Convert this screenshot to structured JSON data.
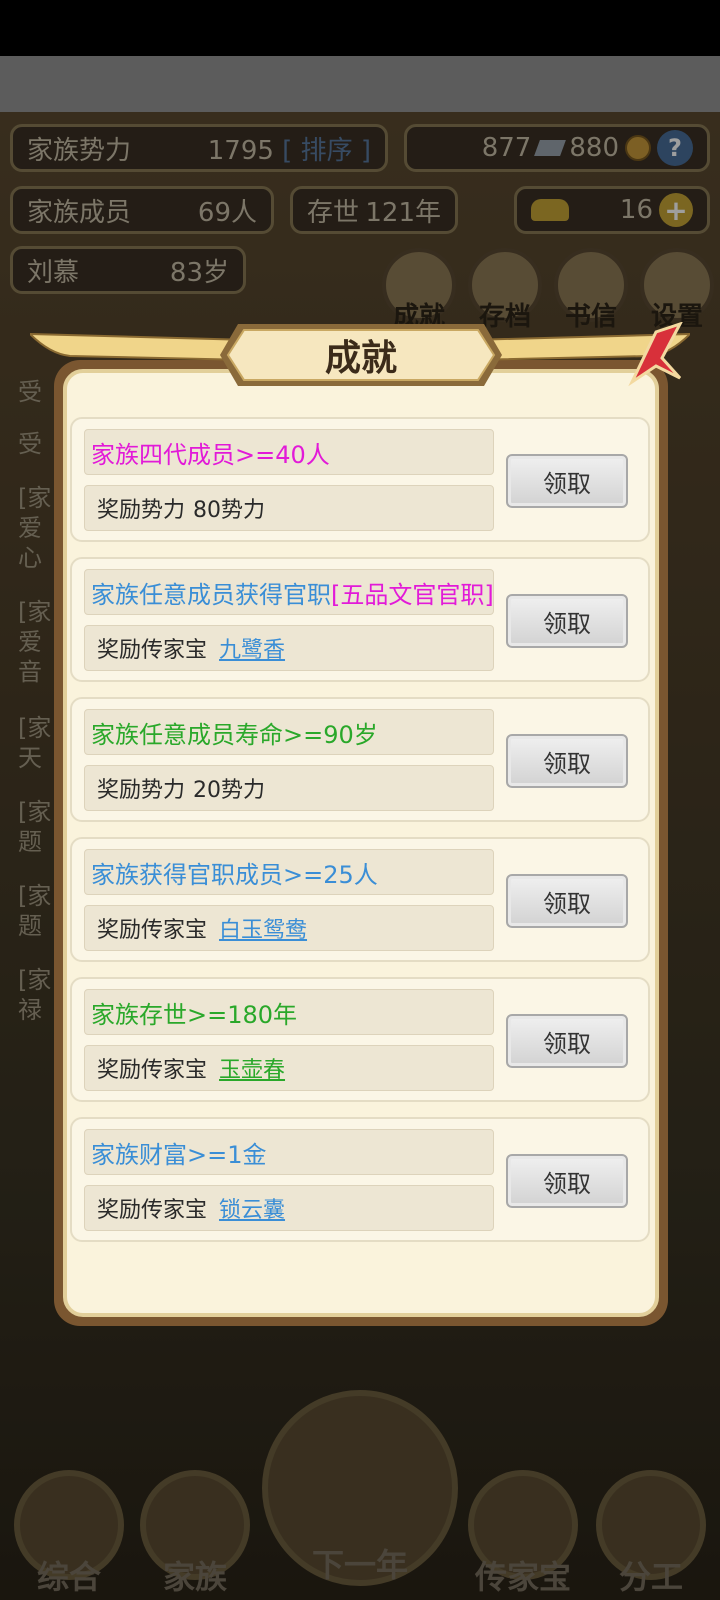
{
  "hud": {
    "power_label": "家族势力",
    "power_value": "1795",
    "power_bracket": "[ 排序 ]",
    "currency_a": "877",
    "currency_b": "880",
    "members_label": "家族成员",
    "members_value": "69人",
    "years_label": "存世",
    "years_value": "121年",
    "gold_value": "16",
    "head_name": "刘慕",
    "head_age": "83岁",
    "menu": [
      "成就",
      "存档",
      "书信",
      "设置"
    ]
  },
  "log_peek": [
    "受",
    "受",
    "[家",
    "爱",
    "心",
    "[家",
    "爱",
    "音",
    "[家",
    "天",
    "[家",
    "题",
    "[家",
    "题",
    "[家",
    "禄"
  ],
  "nav": [
    "综合",
    "家族",
    "下一年",
    "传家宝",
    "分工"
  ],
  "modal": {
    "title": "成就",
    "items": [
      {
        "condition": "家族四代成员>=40人",
        "condition_color": "#e21ad8",
        "condition_extra": "",
        "reward_label": "奖励势力",
        "reward_value": "80势力",
        "reward_is_link": false,
        "reward_color": "#2a2a2a",
        "button": "领取"
      },
      {
        "condition": "家族任意成员获得官职",
        "condition_color": "#3a8ed6",
        "condition_extra": "[五品文官官职]",
        "reward_label": "奖励传家宝",
        "reward_value": "九鹭香",
        "reward_is_link": true,
        "reward_color": "#3a8ed6",
        "button": "领取"
      },
      {
        "condition": "家族任意成员寿命>=90岁",
        "condition_color": "#2aa82a",
        "condition_extra": "",
        "reward_label": "奖励势力",
        "reward_value": "20势力",
        "reward_is_link": false,
        "reward_color": "#2a2a2a",
        "button": "领取"
      },
      {
        "condition": "家族获得官职成员>=25人",
        "condition_color": "#3a8ed6",
        "condition_extra": "",
        "reward_label": "奖励传家宝",
        "reward_value": "白玉鸳鸯",
        "reward_is_link": true,
        "reward_color": "#3a8ed6",
        "button": "领取"
      },
      {
        "condition": "家族存世>=180年",
        "condition_color": "#2aa82a",
        "condition_extra": "",
        "reward_label": "奖励传家宝",
        "reward_value": "玉壶春",
        "reward_is_link": true,
        "reward_color": "#2aa82a",
        "button": "领取"
      },
      {
        "condition": "家族财富>=1金",
        "condition_color": "#3a8ed6",
        "condition_extra": "",
        "reward_label": "奖励传家宝",
        "reward_value": "锁云囊",
        "reward_is_link": true,
        "reward_color": "#3a8ed6",
        "button": "领取"
      }
    ]
  },
  "colors": {
    "modal_bg": "#faf3dc",
    "frame": "#7a5630",
    "magenta": "#e21ad8",
    "blue": "#3a8ed6",
    "green": "#2aa82a"
  }
}
